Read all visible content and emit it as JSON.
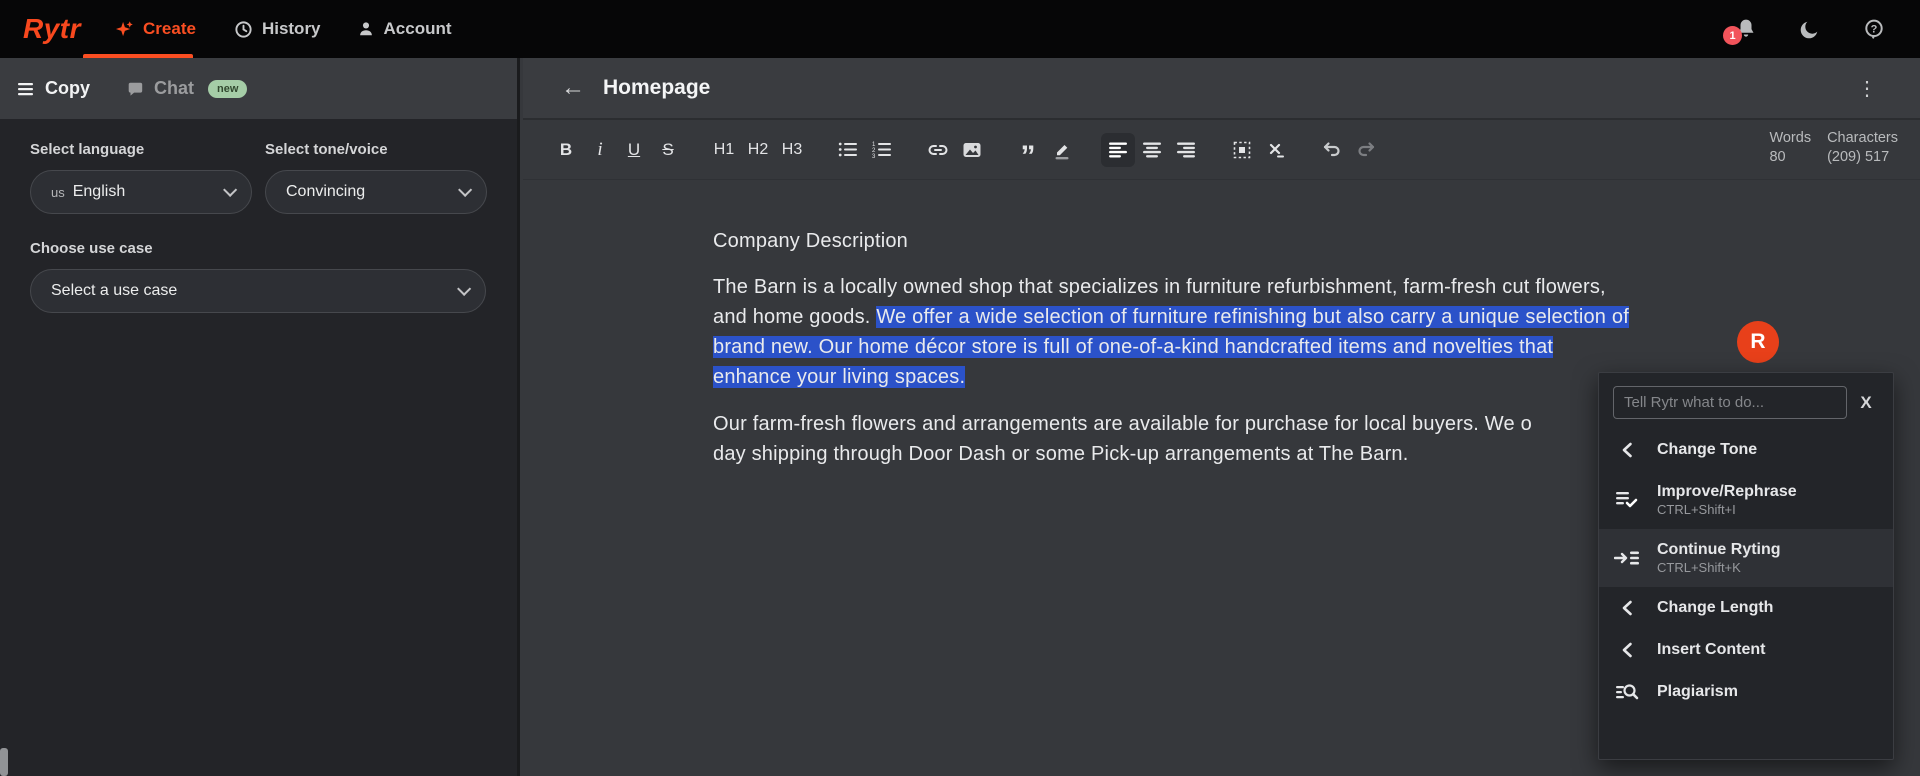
{
  "brand": {
    "logo": "Rytr",
    "accent": "#fa4e22"
  },
  "nav": {
    "tabs": {
      "create": "Create",
      "history": "History",
      "account": "Account"
    },
    "notification_count": "1"
  },
  "sidebar": {
    "tabs": {
      "copy": "Copy",
      "chat": "Chat",
      "chat_badge": "new"
    },
    "language": {
      "label": "Select language",
      "value_prefix": "us",
      "value": "English"
    },
    "tone": {
      "label": "Select tone/voice",
      "value": "Convincing"
    },
    "use_case": {
      "label": "Choose use case",
      "value": "Select a use case"
    }
  },
  "editor": {
    "title": "Homepage",
    "kebab": "⋮",
    "back": "←",
    "toolbar": {
      "bold": "B",
      "italic": "i",
      "underline": "U",
      "strike": "S",
      "h1": "H1",
      "h2": "H2",
      "h3": "H3",
      "quote": "”"
    },
    "counters": {
      "words_label": "Words",
      "words_value": "80",
      "chars_label": "Characters",
      "chars_value": "(209) 517"
    }
  },
  "document": {
    "heading": "Company Description",
    "p1_lines": [
      {
        "plain": "The Barn is a locally owned shop that specializes in furniture refurbishment, farm-fresh cut flowers,",
        "hl": ""
      },
      {
        "plain": "and home goods. ",
        "hl": "We offer a wide selection of furniture refinishing but also carry a unique selection of"
      },
      {
        "plain": "",
        "hl": "brand new. Our home décor store is full of one-of-a-kind handcrafted items and novelties that"
      },
      {
        "plain": "",
        "hl": "enhance your living spaces."
      }
    ],
    "p2_lines": [
      "Our farm-fresh flowers and arrangements are available for purchase for local buyers. We o",
      "day shipping through Door Dash or some Pick-up arrangements at The Barn."
    ]
  },
  "avatar": {
    "letter": "R",
    "color": "#e8401a"
  },
  "menu": {
    "input_placeholder": "Tell Rytr what to do...",
    "close_label": "X",
    "items": [
      {
        "label": "Change Tone",
        "shortcut": ""
      },
      {
        "label": "Improve/Rephrase",
        "shortcut": "CTRL+Shift+I"
      },
      {
        "label": "Continue Ryting",
        "shortcut": "CTRL+Shift+K"
      },
      {
        "label": "Change Length",
        "shortcut": ""
      },
      {
        "label": "Insert Content",
        "shortcut": ""
      },
      {
        "label": "Plagiarism",
        "shortcut": ""
      }
    ]
  }
}
